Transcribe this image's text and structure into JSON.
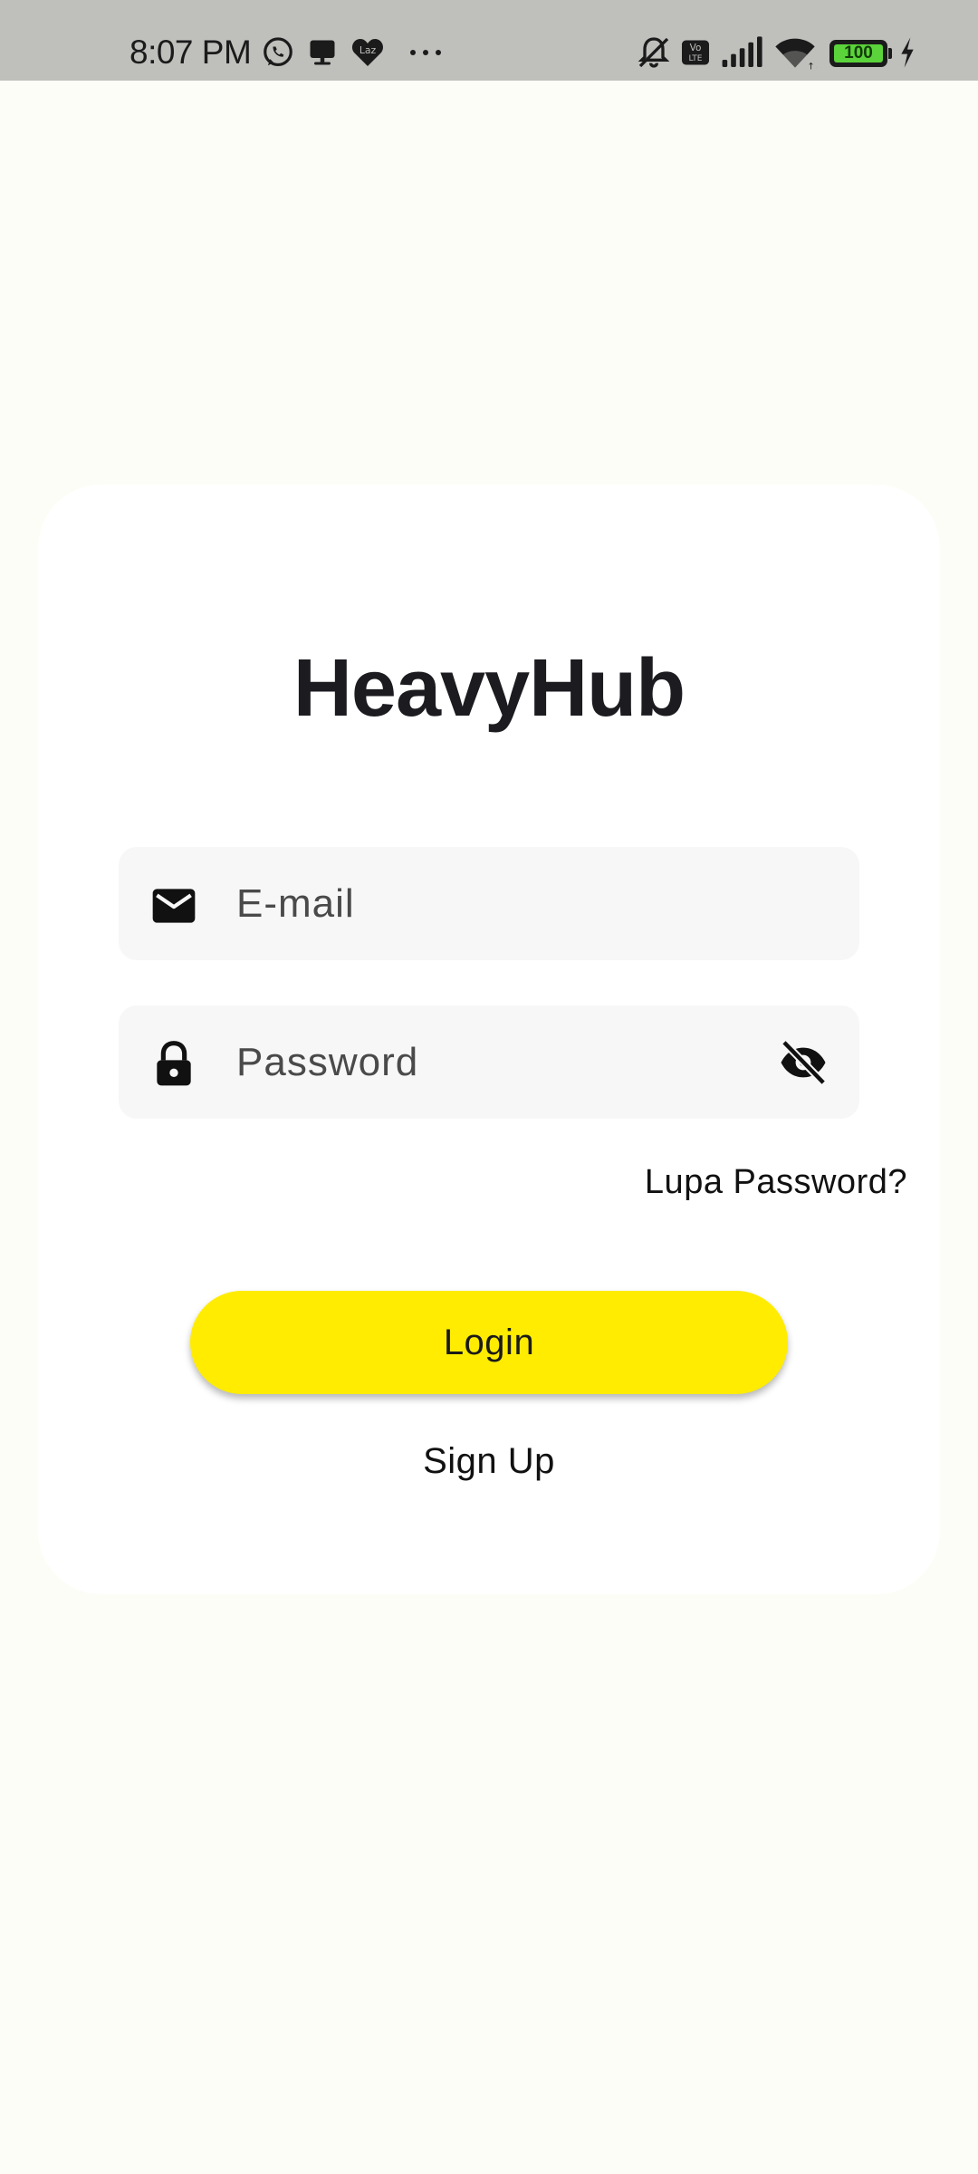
{
  "status_bar": {
    "time": "8:07 PM",
    "icons": [
      "whatsapp-icon",
      "notification-icon",
      "lazada-icon",
      "more-icon",
      "silent-bell-icon",
      "volte-icon",
      "signal-icon",
      "wifi-icon",
      "battery-icon",
      "charging-icon"
    ],
    "lazada_label": "Laz",
    "volte_label": "Vo LTE",
    "battery_level": "100"
  },
  "app": {
    "title": "HeavyHub"
  },
  "form": {
    "email_placeholder": "E-mail",
    "email_value": "",
    "password_placeholder": "Password",
    "password_value": "",
    "forgot_password_label": "Lupa Password?",
    "login_label": "Login",
    "signup_label": "Sign Up"
  },
  "colors": {
    "background": "#fdfdf7",
    "card": "#ffffff",
    "field": "#f7f7f7",
    "accent": "#ffec00",
    "status_bar": "#bfbfbc"
  }
}
